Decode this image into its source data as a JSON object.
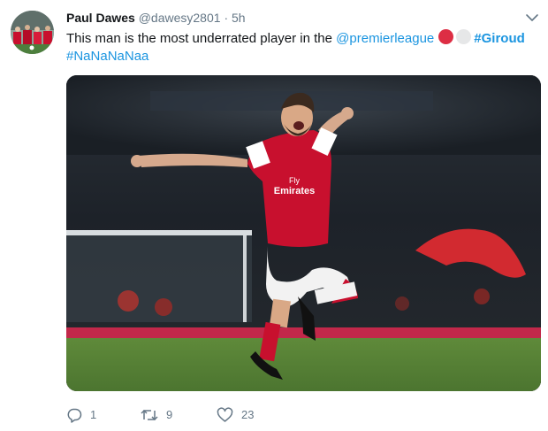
{
  "author": {
    "name": "Paul Dawes",
    "handle": "@dawesy2801",
    "separator": "·",
    "time": "5h"
  },
  "tweet": {
    "text_part1": "This man is the most underrated player in the ",
    "mention": "@premierleague",
    "hashtag1": "#Giroud",
    "hashtag2": "#NaNaNaNaa",
    "emoji_colors": [
      "#dd2e44",
      "#e6e7e8"
    ]
  },
  "media": {
    "shirt_sponsor_line1": "Fly",
    "shirt_sponsor_line2": "Emirates",
    "kit_color": "#c8102e"
  },
  "actions": {
    "reply_count": "1",
    "retweet_count": "9",
    "like_count": "23"
  },
  "icons": [
    "chevron-down-icon",
    "reply-icon",
    "retweet-icon",
    "like-icon"
  ]
}
